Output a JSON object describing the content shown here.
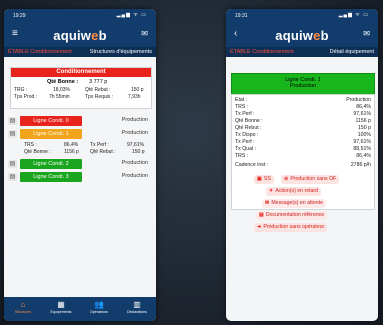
{
  "left": {
    "status": {
      "time": "19:29",
      "signal": "▂▄▆ ᯤ ▭"
    },
    "app": {
      "logo_main": "aquiw",
      "logo_accent": "e",
      "logo_tail": "b",
      "menu_icon": "hamburger-menu-icon",
      "mail_icon": "mail-icon"
    },
    "subbar": {
      "plant": "ÉTABLE Conditionnement",
      "title": "Structures d'équipements"
    },
    "summary": {
      "header": "Conditionnement",
      "good_label": "Qté Bonne :",
      "good_value": "3 777 p",
      "trg_label": "TRG :",
      "trg_value": "18,03%",
      "scrap_label": "Qté Rebut :",
      "scrap_value": "150 p",
      "prod_time_label": "Tps Prod :",
      "prod_time_value": "7h 55min",
      "req_time_label": "Tps Requis :",
      "req_time_value": "7,93h"
    },
    "lines": [
      {
        "name": "Ligne Condi. 0",
        "state": "Production",
        "color": "#e8231b"
      },
      {
        "name": "Ligne Condi. 1",
        "state": "Production",
        "color": "#f2a51a"
      },
      {
        "name": "Ligne Condi. 2",
        "state": "Production",
        "color": "#19a51d"
      },
      {
        "name": "Ligne Condi. 3",
        "state": "Production",
        "color": "#19a51d"
      }
    ],
    "line1_detail": {
      "trs_label": "TRS :",
      "trs_value": "86,4%",
      "perf_label": "Tx Perf :",
      "perf_value": "97,61%",
      "good_label": "Qté Bonne :",
      "good_value": "1156 p",
      "scrap_label": "Qté Rebut :",
      "scrap_value": "150 p"
    },
    "nav": [
      {
        "label": "Structures",
        "icon": "structure-icon",
        "active": true
      },
      {
        "label": "Équipements",
        "icon": "equipment-icon",
        "active": false
      },
      {
        "label": "Opérateurs",
        "icon": "operators-icon",
        "active": false
      },
      {
        "label": "Déclarations",
        "icon": "clipboard-icon",
        "active": false
      }
    ]
  },
  "right": {
    "status": {
      "time": "19:31",
      "signal": "▂▄▆ ᯤ ▭"
    },
    "app": {
      "back_icon": "back-arrow-icon",
      "mail_icon": "mail-icon"
    },
    "subbar": {
      "plant": "ÉTABLE Conditionnement",
      "title": "Détail équipement"
    },
    "equipment": {
      "name": "Ligne Condi. 1",
      "state": "Production",
      "color": "#19b51d"
    },
    "details": [
      {
        "k": "Etat :",
        "v": "Production"
      },
      {
        "k": "TRS :",
        "v": "86,4%"
      },
      {
        "k": "Tx Perf :",
        "v": "97,61%"
      },
      {
        "k": "Qté Bonne :",
        "v": "1156 p"
      },
      {
        "k": "Qté Rebut :",
        "v": "150 p"
      },
      {
        "k": "Tx Dispo :",
        "v": "100%"
      },
      {
        "k": "Tx Perf :",
        "v": "97,61%"
      },
      {
        "k": "Tx Qual :",
        "v": "88,51%"
      },
      {
        "k": "TRS :",
        "v": "86,4%"
      },
      {
        "k": "Cadence inst :",
        "v": "2786 p/h"
      }
    ],
    "actions": {
      "ss_label": "SS",
      "no_of_label": "Production sans OF",
      "late_label": "Action(s) en retard",
      "messages_label": "Message(s) en attente",
      "docs_label": "Documentation référence",
      "no_operator_label": "Production sans opérateur"
    }
  }
}
